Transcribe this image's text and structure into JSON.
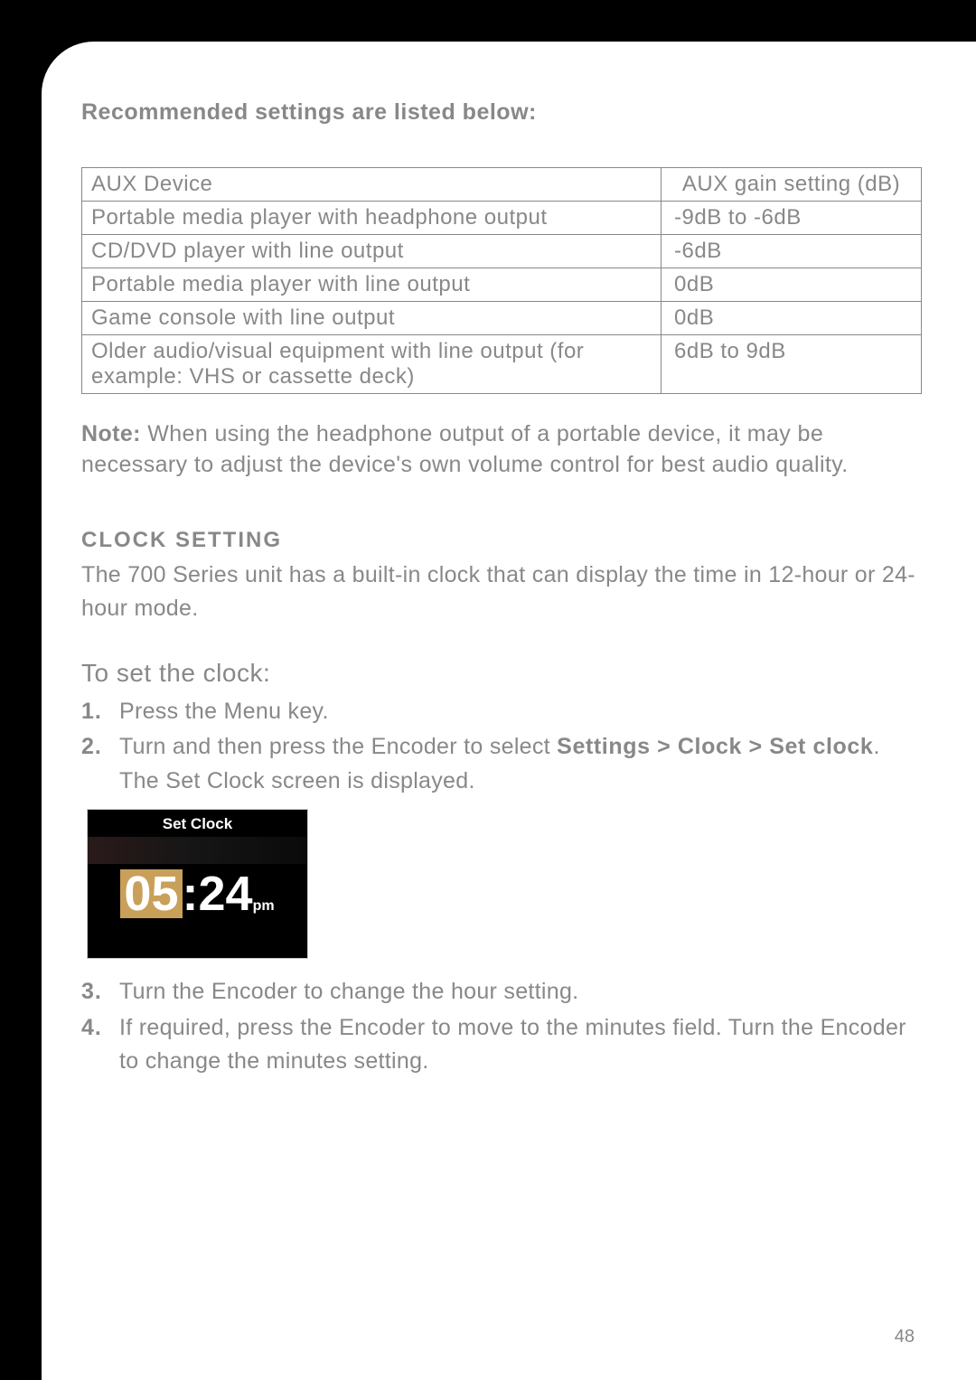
{
  "intro": "Recommended settings are listed below:",
  "table": {
    "headers": {
      "device": "AUX Device",
      "gain": "AUX gain setting (dB)"
    },
    "rows": [
      {
        "device": "Portable media player with headphone output",
        "gain": "-9dB to -6dB"
      },
      {
        "device": "CD/DVD player with line output",
        "gain": "-6dB"
      },
      {
        "device": "Portable media player with line output",
        "gain": "0dB"
      },
      {
        "device": "Game console with line output",
        "gain": "0dB"
      },
      {
        "device": "Older audio/visual equipment with line output (for example: VHS or cassette deck)",
        "gain": "6dB to 9dB"
      }
    ]
  },
  "note_label": "Note:",
  "note_body": " When using the headphone output of a portable device, it may be necessary to adjust the device's own volume control for best audio quality.",
  "section": {
    "heading": "CLOCK SETTING",
    "desc": "The 700 Series unit has a built-in clock that can display the time in 12-hour or 24-hour mode."
  },
  "subhead": "To set the clock:",
  "steps": {
    "s1_num": "1.",
    "s1_txt": "Press the Menu key.",
    "s2_num": "2.",
    "s2_pre": "Turn and then press the Encoder to select ",
    "s2_kw": "Settings > Clock > Set clock",
    "s2_post": ". The Set Clock screen is displayed.",
    "s3_num": "3.",
    "s3_txt": "Turn the Encoder to change the hour setting.",
    "s4_num": "4.",
    "s4_txt": "If required, press the Encoder to move to the minutes field. Turn the Encoder to change the minutes setting."
  },
  "clock_screen": {
    "title": "Set Clock",
    "hour": "05",
    "colon": ":",
    "minute": "24",
    "ampm": "pm"
  },
  "page_number": "48",
  "chart_data": {
    "type": "table",
    "title": "Recommended AUX gain settings",
    "columns": [
      "AUX Device",
      "AUX gain setting (dB)"
    ],
    "rows": [
      [
        "Portable media player with headphone output",
        "-9dB to -6dB"
      ],
      [
        "CD/DVD player with line output",
        "-6dB"
      ],
      [
        "Portable media player with line output",
        "0dB"
      ],
      [
        "Game console with line output",
        "0dB"
      ],
      [
        "Older audio/visual equipment with line output (for example: VHS or cassette deck)",
        "6dB to 9dB"
      ]
    ]
  }
}
